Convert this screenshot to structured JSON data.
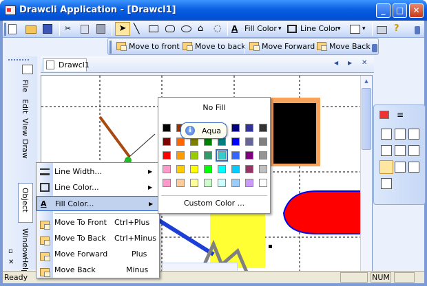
{
  "window": {
    "title": "Drawcli Application - [Drawcl1]",
    "minimize": "_",
    "maximize": "□",
    "close": "✕"
  },
  "toolbar": {
    "fill_color": "Fill Color",
    "line_color": "Line Color",
    "dropdown": "▾",
    "font_label": "A",
    "help": "?"
  },
  "arrange_toolbar": {
    "move_to_front": "Move to front",
    "move_to_back": "Move to back",
    "move_forward": "Move Forward",
    "move_back": "Move Back"
  },
  "side_menu": {
    "file": "File",
    "edit": "Edit",
    "view": "View",
    "draw": "Draw",
    "object": "Object",
    "window": "Window",
    "help": "Help"
  },
  "document": {
    "tab": "Drawcl1",
    "prev": "◀",
    "next": "▶",
    "close": "✕"
  },
  "context_menu": {
    "items": [
      {
        "label": "Line Width...",
        "shortcut": "",
        "submenu": true
      },
      {
        "label": "Line Color...",
        "shortcut": "",
        "submenu": true
      },
      {
        "label": "Fill Color...",
        "shortcut": "",
        "submenu": true
      },
      {
        "label": "Move To Front",
        "shortcut": "Ctrl+Plus"
      },
      {
        "label": "Move To Back",
        "shortcut": "Ctrl+Minus"
      },
      {
        "label": "Move Forward",
        "shortcut": "Plus"
      },
      {
        "label": "Move Back",
        "shortcut": "Minus"
      }
    ],
    "arrow": "▶"
  },
  "palette": {
    "no_fill": "No Fill",
    "custom": "Custom Color ...",
    "tooltip": "Aqua",
    "selected": "#33cccc",
    "rows": [
      [
        "#000000",
        "#993300",
        "#333300",
        "#003300",
        "#003366",
        "#000080",
        "#333399",
        "#333333"
      ],
      [
        "#800000",
        "#ff6600",
        "#808000",
        "#008000",
        "#008080",
        "#0000ff",
        "#666699",
        "#808080"
      ],
      [
        "#ff0000",
        "#ff9900",
        "#99cc00",
        "#339966",
        "#33cccc",
        "#3366ff",
        "#800080",
        "#969696"
      ],
      [
        "#ff99cc",
        "#ffcc00",
        "#ffff00",
        "#00ff00",
        "#00ffff",
        "#00ccff",
        "#993366",
        "#c0c0c0"
      ],
      [
        "#ff99cc",
        "#ffcc99",
        "#ffff99",
        "#ccffcc",
        "#ccffff",
        "#99ccff",
        "#cc99ff",
        "#ffffff"
      ]
    ]
  },
  "status": {
    "text": "Ready",
    "num": "NUM"
  }
}
